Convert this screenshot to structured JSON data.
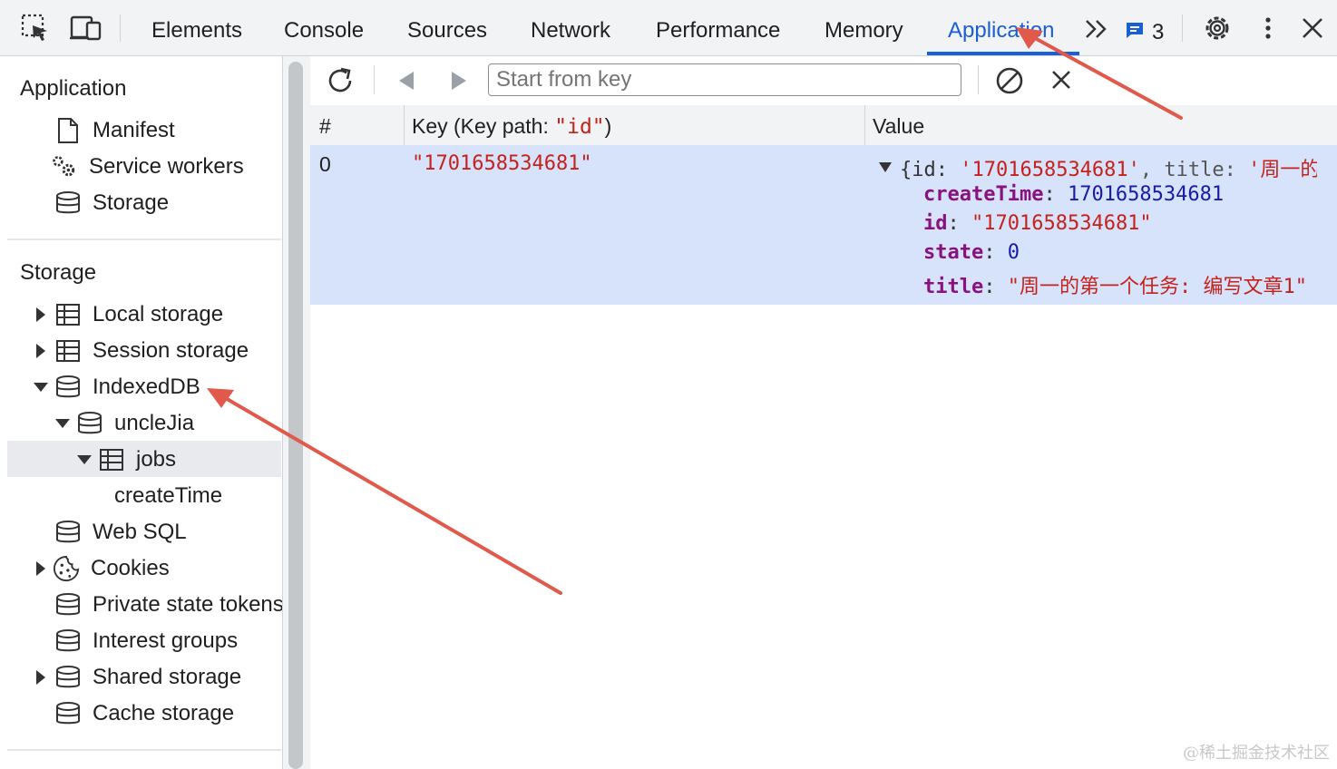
{
  "topbar": {
    "tabs": [
      "Elements",
      "Console",
      "Sources",
      "Network",
      "Performance",
      "Memory",
      "Application"
    ],
    "active_tab": "Application",
    "more_label": ">>",
    "message_count": "3"
  },
  "sidebar": {
    "application_section": {
      "title": "Application",
      "items": [
        "Manifest",
        "Service workers",
        "Storage"
      ]
    },
    "storage_section": {
      "title": "Storage",
      "items": {
        "local_storage": "Local storage",
        "session_storage": "Session storage",
        "indexeddb": "IndexedDB",
        "db": "uncleJia",
        "store": "jobs",
        "index": "createTime",
        "web_sql": "Web SQL",
        "cookies": "Cookies",
        "private_state_tokens": "Private state tokens",
        "interest_groups": "Interest groups",
        "shared_storage": "Shared storage",
        "cache_storage": "Cache storage"
      }
    }
  },
  "main": {
    "search_placeholder": "Start from key",
    "table": {
      "headers": {
        "index": "#",
        "key_prefix": "Key (Key path: ",
        "key_path": "\"id\"",
        "key_suffix": ")",
        "value": "Value"
      },
      "rows": [
        {
          "index": "0",
          "key": "\"1701658534681\"",
          "value_summary": {
            "open": "{id: ",
            "id": "'1701658534681'",
            "sep": ", title: ",
            "title": "'周一的"
          },
          "fields": {
            "createTime": "1701658534681",
            "id": "\"1701658534681\"",
            "state": "0",
            "title": "\"周一的第一个任务: 编写文章1\""
          }
        }
      ]
    }
  },
  "watermark": "@稀土掘金技术社区",
  "colors": {
    "accent": "#1a5fd6",
    "annotation_arrow": "#e0594a",
    "row_highlight": "#d7e2fb"
  }
}
